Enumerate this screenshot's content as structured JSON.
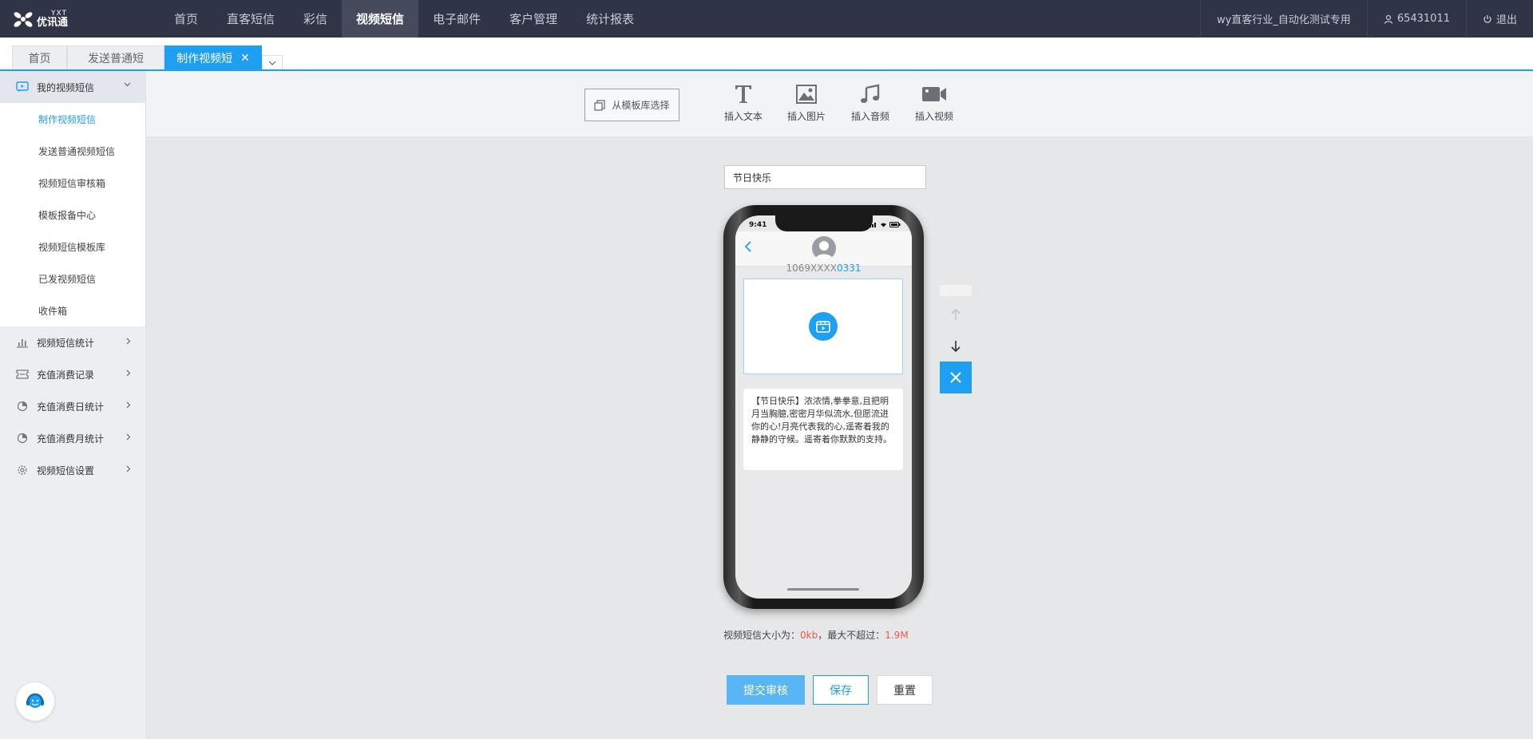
{
  "brand": {
    "name_en": "YXT",
    "name_cn": "优讯通"
  },
  "nav": {
    "items": [
      {
        "label": "首页"
      },
      {
        "label": "直客短信"
      },
      {
        "label": "彩信"
      },
      {
        "label": "视频短信"
      },
      {
        "label": "电子邮件"
      },
      {
        "label": "客户管理"
      },
      {
        "label": "统计报表"
      }
    ],
    "active_index": 3
  },
  "top_right": {
    "account_name": "wy直客行业_自动化测试专用",
    "user_id": "65431011",
    "logout": "退出"
  },
  "tabs": [
    {
      "label": "首页"
    },
    {
      "label": "发送普通短"
    },
    {
      "label": "制作视频短",
      "close": "✕"
    }
  ],
  "sidebar": {
    "groups": [
      {
        "label": "我的视频短信",
        "icon": "video-message-icon"
      },
      {
        "label": "视频短信统计",
        "icon": "bar-chart-icon"
      },
      {
        "label": "充值消费记录",
        "icon": "ticket-icon"
      },
      {
        "label": "充值消费日统计",
        "icon": "pie-chart-icon"
      },
      {
        "label": "充值消费月统计",
        "icon": "pie-chart-icon"
      },
      {
        "label": "视频短信设置",
        "icon": "gear-icon"
      }
    ],
    "sub_items": [
      {
        "label": "制作视频短信"
      },
      {
        "label": "发送普通视频短信"
      },
      {
        "label": "视频短信审核箱"
      },
      {
        "label": "模板报备中心"
      },
      {
        "label": "视频短信模板库"
      },
      {
        "label": "已发视频短信"
      },
      {
        "label": "收件箱"
      }
    ]
  },
  "toolbar": {
    "template_button": "从模板库选择",
    "insert_text": "插入文本",
    "insert_image": "插入图片",
    "insert_audio": "插入音频",
    "insert_video": "插入视频"
  },
  "editor": {
    "title_value": "节日快乐",
    "phone_time": "9:41",
    "number_prefix": "1069XXXX",
    "number_suffix": "0331",
    "sms_text": "【节日快乐】浓浓情,拳拳意,且把明月当胸臆,密密月华似流水,但愿流进你的心!月亮代表我的心,遥寄着我的静静的守候。遥寄着你默默的支持。"
  },
  "size_info": {
    "label": "视频短信大小为：",
    "current": "0kb",
    "separator": "，最大不超过：",
    "max": "1.9M"
  },
  "buttons": {
    "submit": "提交审核",
    "save": "保存",
    "reset": "重置"
  },
  "colors": {
    "nav_bg": "#2f3446",
    "accent": "#1e9ff2",
    "warning": "#f05a4a"
  }
}
